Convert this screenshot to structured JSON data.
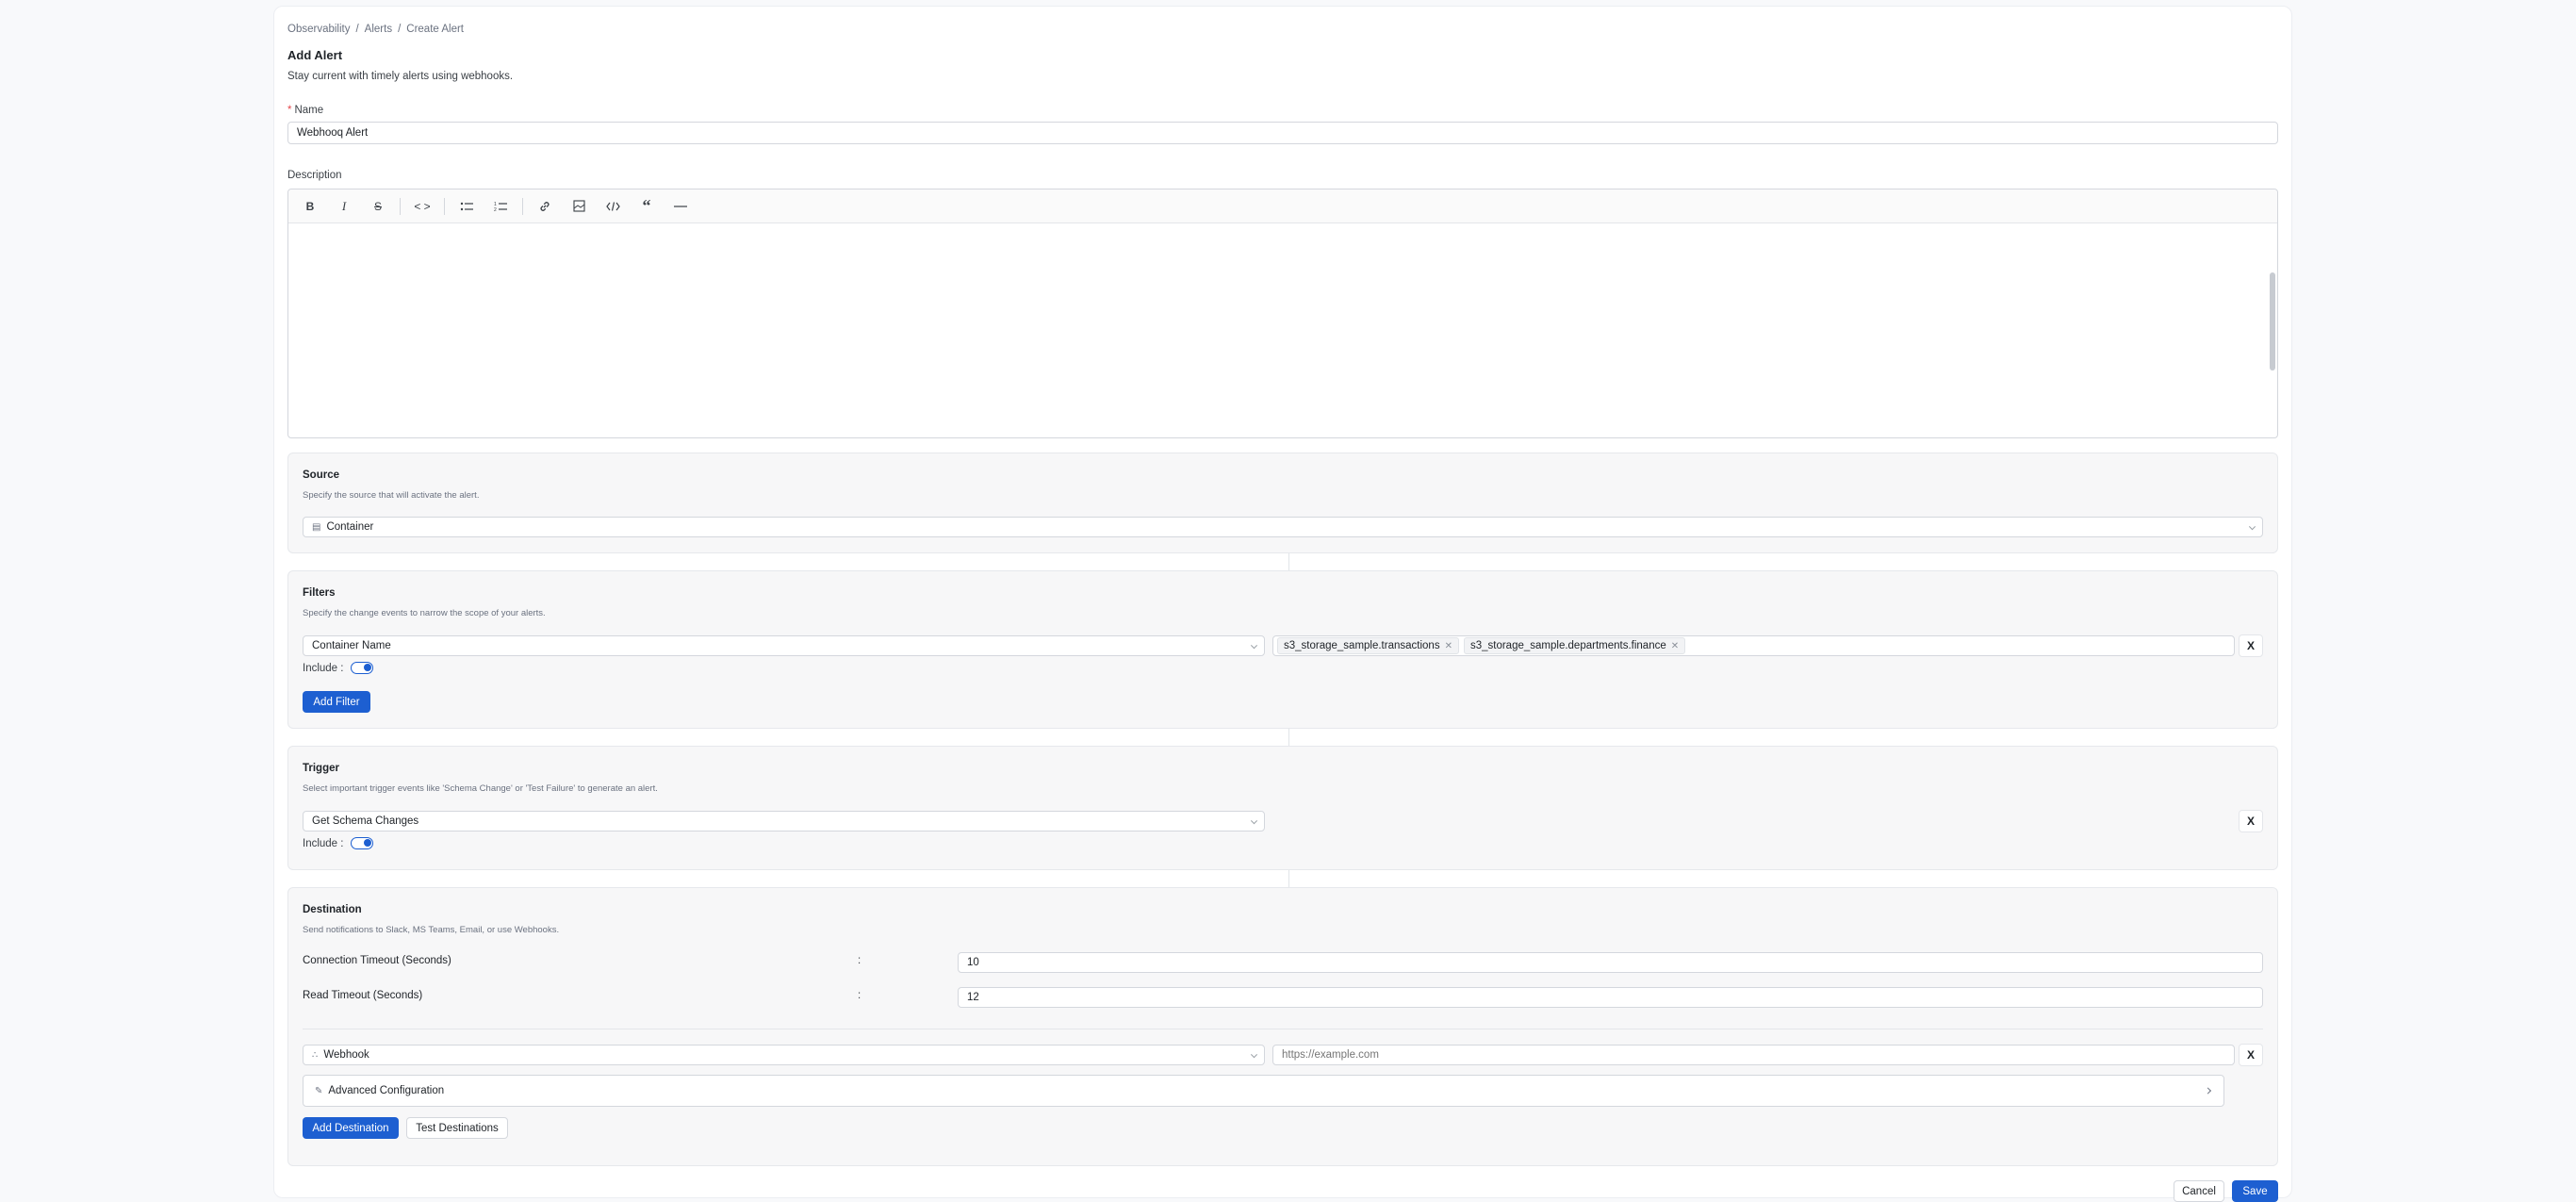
{
  "breadcrumb": [
    "Observability",
    "Alerts",
    "Create Alert"
  ],
  "breadcrumb_separator": "/",
  "title": "Add Alert",
  "subtitle": "Stay current with timely alerts using webhooks.",
  "name_field": {
    "required_mark": "*",
    "label": "Name",
    "value": "Webhooq Alert"
  },
  "description": {
    "label": "Description"
  },
  "source": {
    "title": "Source",
    "description": "Specify the source that will activate the alert.",
    "selected": "Container",
    "icon": "container-icon"
  },
  "filters": {
    "title": "Filters",
    "description": "Specify the change events to narrow the scope of your alerts.",
    "field": "Container Name",
    "tags": [
      "s3_storage_sample.transactions",
      "s3_storage_sample.departments.finance"
    ],
    "include_label": "Include :",
    "include_on": true,
    "remove_label": "X",
    "add_button": "Add Filter"
  },
  "trigger": {
    "title": "Trigger",
    "description": "Select important trigger events like 'Schema Change' or 'Test Failure' to generate an alert.",
    "selected": "Get Schema Changes",
    "include_label": "Include :",
    "include_on": true,
    "remove_label": "X"
  },
  "destination": {
    "title": "Destination",
    "description": "Send notifications to Slack, MS Teams, Email, or use Webhooks.",
    "connection_timeout_label": "Connection Timeout (Seconds)",
    "connection_timeout_value": "10",
    "read_timeout_label": "Read Timeout (Seconds)",
    "read_timeout_value": "12",
    "colon": ":",
    "type": "Webhook",
    "url_placeholder": "https://example.com",
    "remove_label": "X",
    "advanced_label": "Advanced Configuration",
    "add_button": "Add Destination",
    "test_button": "Test Destinations"
  },
  "footer": {
    "cancel": "Cancel",
    "save": "Save"
  },
  "colors": {
    "primary": "#1d5fd1",
    "required": "#e5484d",
    "panel_bg": "#f7f7f8"
  }
}
